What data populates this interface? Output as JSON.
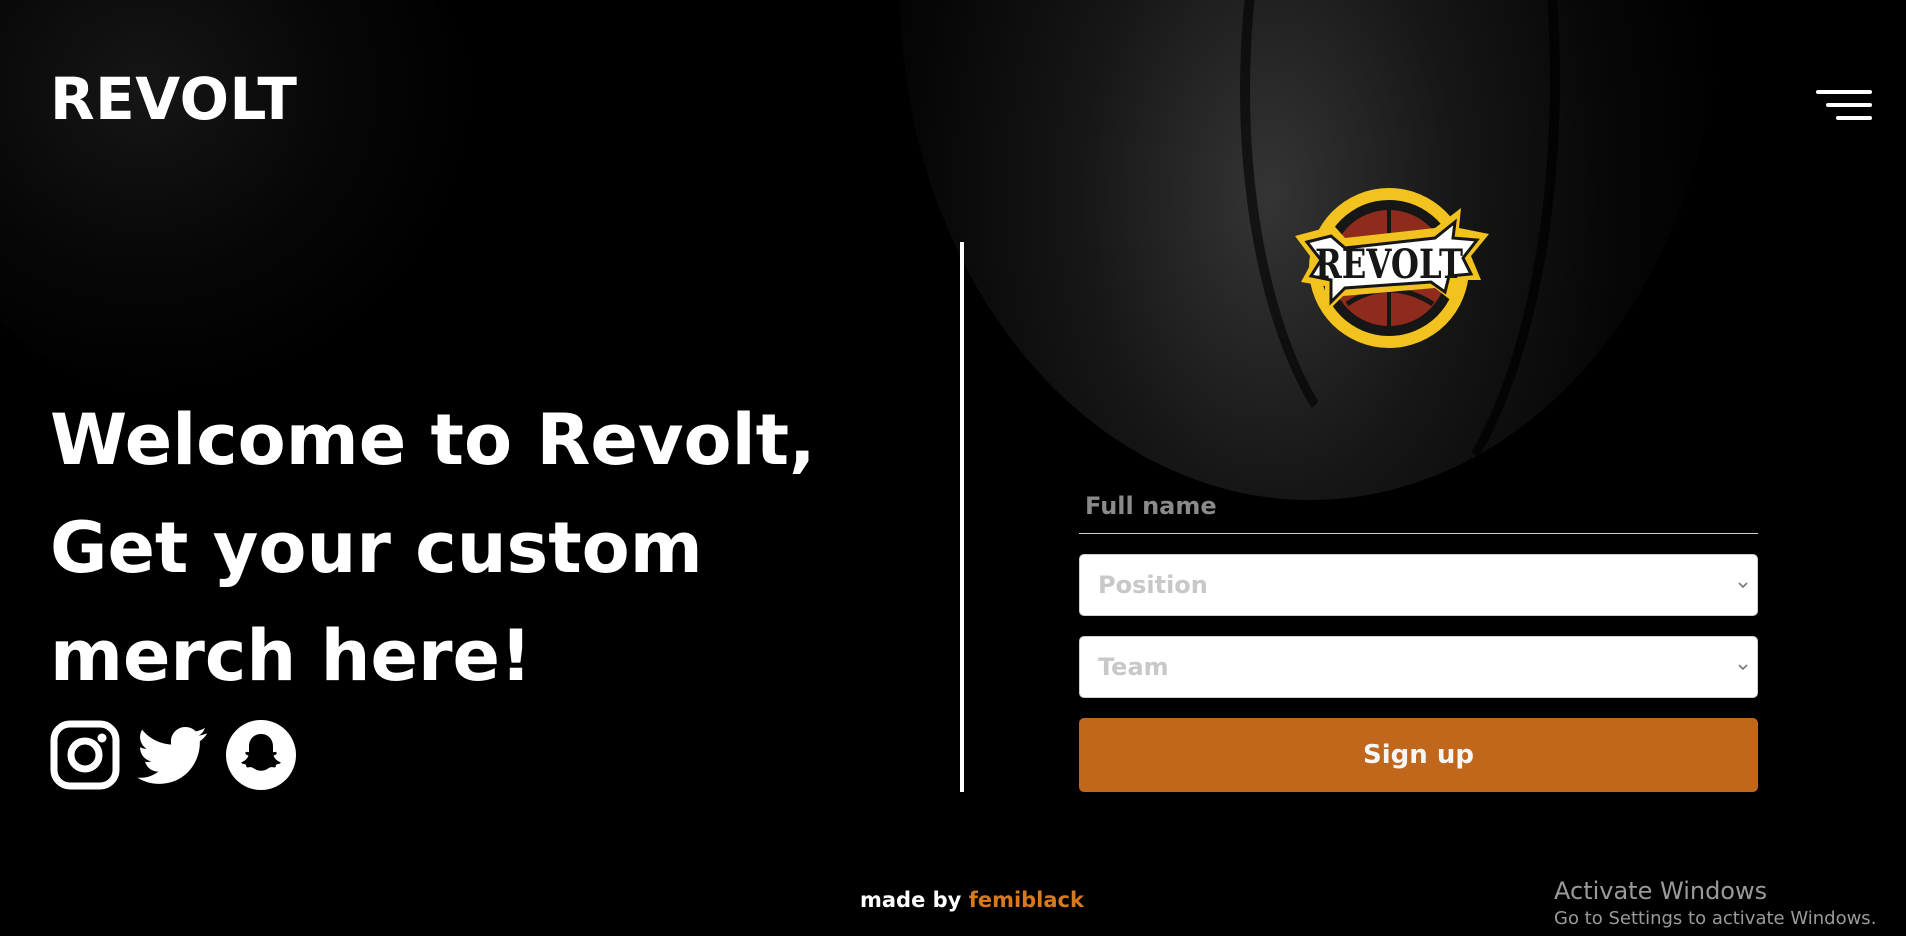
{
  "header": {
    "brand": "REVOLT",
    "menu_icon": "hamburger-menu-icon"
  },
  "hero": {
    "headline": "Welcome to Revolt, Get your custom merch here!",
    "socials": [
      {
        "name": "instagram-icon"
      },
      {
        "name": "twitter-icon"
      },
      {
        "name": "snapchat-icon"
      }
    ]
  },
  "logo": {
    "text": "REVOLT"
  },
  "form": {
    "full_name_placeholder": "Full name",
    "full_name_value": "",
    "position": {
      "selected": "Position"
    },
    "team": {
      "selected": "Team"
    },
    "submit_label": "Sign up"
  },
  "footer": {
    "made_by": "made by",
    "author": "femiblack"
  },
  "watermark": {
    "title": "Activate Windows",
    "subtitle": "Go to Settings to activate Windows."
  },
  "colors": {
    "background": "#000000",
    "accent": "#c0671b",
    "author_link": "#d77a1f",
    "logo_gold": "#f2c21e",
    "logo_red": "#8e2b1d"
  }
}
